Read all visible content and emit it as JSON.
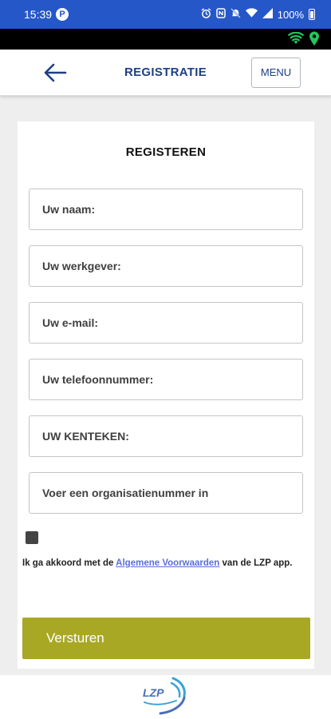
{
  "status_bar": {
    "time": "15:39",
    "notification_badge": "P",
    "battery": "100%",
    "icons": [
      "alarm-icon",
      "nfc-icon",
      "mute-icon",
      "wifi-icon",
      "signal-icon",
      "battery-icon"
    ]
  },
  "overlay_icons": [
    "wifi-icon",
    "location-pin-icon"
  ],
  "app_bar": {
    "title": "REGISTRATIE",
    "menu_label": "MENU",
    "back_icon": "back-arrow-icon"
  },
  "form": {
    "title": "REGISTEREN",
    "fields": [
      {
        "placeholder": "Uw naam:",
        "value": ""
      },
      {
        "placeholder": "Uw werkgever:",
        "value": ""
      },
      {
        "placeholder": "Uw e-mail:",
        "value": ""
      },
      {
        "placeholder": "Uw telefoonnummer:",
        "value": ""
      },
      {
        "placeholder": "UW KENTEKEN:",
        "value": ""
      },
      {
        "placeholder": "Voer een organisatienummer in",
        "value": ""
      }
    ],
    "terms": {
      "prefix": "Ik ga akkoord met de ",
      "link": "Algemene Voorwaarden",
      "suffix": " van de LZP app."
    },
    "submit_label": "Versturen"
  },
  "footer": {
    "logo_text": "LZP"
  },
  "colors": {
    "status_bar": "#2557c9",
    "primary_text": "#1d3f86",
    "submit": "#a8a825",
    "link": "#5b6fd6",
    "overlay_green": "#22c55e"
  }
}
